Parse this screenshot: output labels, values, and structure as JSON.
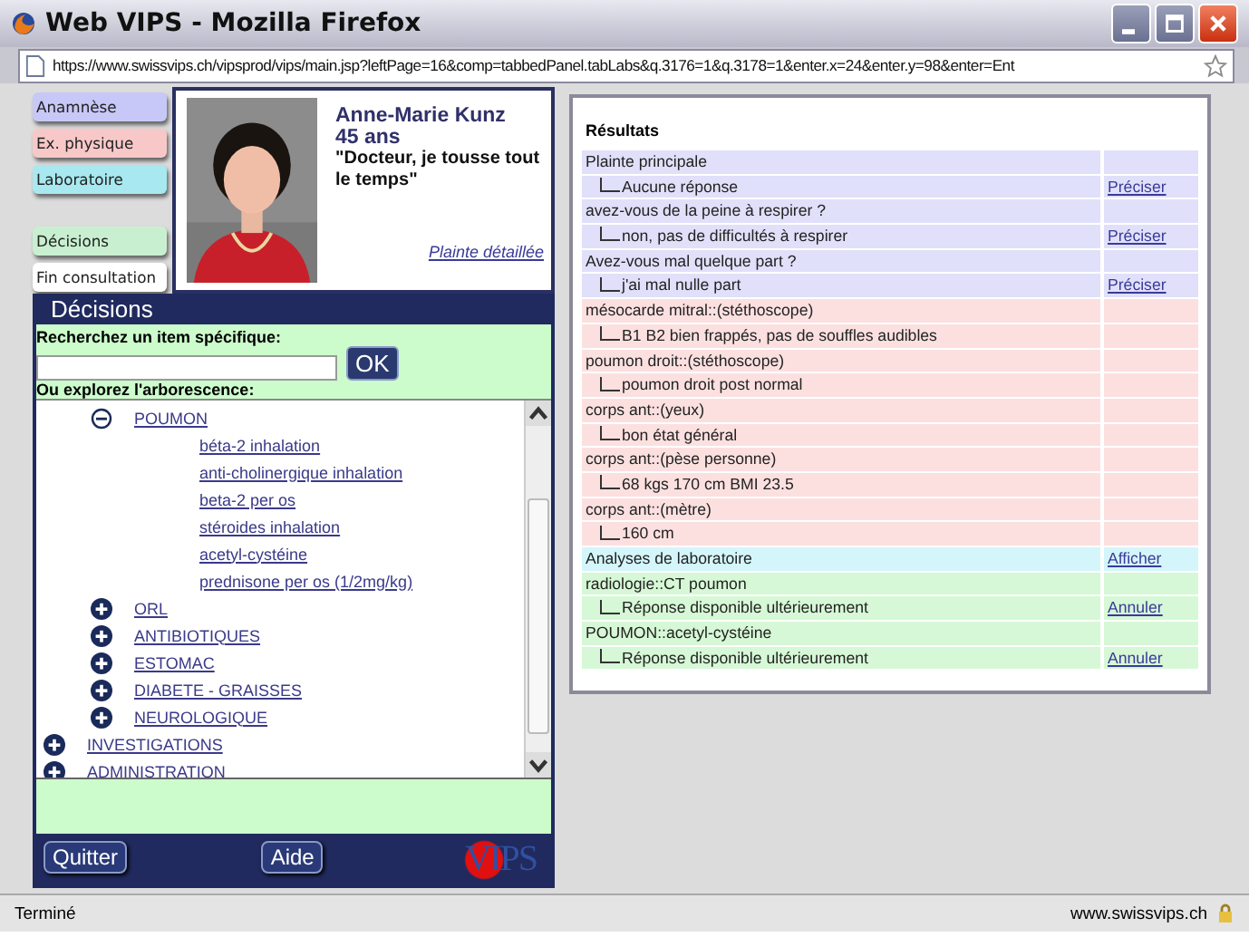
{
  "window": {
    "title": "Web VIPS - Mozilla Firefox"
  },
  "address_bar": {
    "url": "https://www.swissvips.ch/vipsprod/vips/main.jsp?leftPage=16&comp=tabbedPanel.tabLabs&q.3176=1&q.3178=1&enter.x=24&enter.y=98&enter=Ent"
  },
  "tabs": [
    {
      "label": "Anamnèse",
      "color": "#c8c8f8"
    },
    {
      "label": "Ex. physique",
      "color": "#f8c8c8"
    },
    {
      "label": "Laboratoire",
      "color": "#a8e8f0"
    },
    {
      "label": "Décisions",
      "color": "#c8f0d0"
    },
    {
      "label": "Fin consultation",
      "color": "#ffffff"
    }
  ],
  "patient": {
    "name": "Anne-Marie Kunz",
    "age": "45 ans",
    "complaint": "\"Docteur, je tousse tout le temps\"",
    "link": "Plainte détaillée"
  },
  "decisions": {
    "title": "Décisions",
    "search_label": "Recherchez un item spécifique:",
    "search_button": "OK",
    "tree_label": "Ou explorez l'arborescence:",
    "tree": [
      {
        "children": [
          {
            "label": "POUMON",
            "expanded": true,
            "children": [
              {
                "label": "béta-2 inhalation"
              },
              {
                "label": "anti-cholinergique inhalation"
              },
              {
                "label": "beta-2 per os"
              },
              {
                "label": "stéroides inhalation"
              },
              {
                "label": "acetyl-cystéine"
              },
              {
                "label": "prednisone per os (1/2mg/kg)"
              }
            ]
          },
          {
            "label": "ORL",
            "expanded": false
          },
          {
            "label": "ANTIBIOTIQUES",
            "expanded": false
          },
          {
            "label": "ESTOMAC",
            "expanded": false
          },
          {
            "label": "DIABETE - GRAISSES",
            "expanded": false
          },
          {
            "label": "NEUROLOGIQUE",
            "expanded": false
          }
        ]
      },
      {
        "label": "INVESTIGATIONS",
        "expanded": false
      },
      {
        "label": "ADMINISTRATION",
        "expanded": false
      }
    ],
    "buttons": [
      "Quitter",
      "Aide"
    ],
    "logo": "VIPS"
  },
  "results": {
    "title": "Résultats",
    "rows": [
      {
        "kind": "question",
        "text": "Plainte principale",
        "color": "#e0e0fa"
      },
      {
        "kind": "answer",
        "text": "Aucune réponse",
        "link": "Préciser",
        "color": "#e0e0fa"
      },
      {
        "kind": "question",
        "text": "avez-vous de la peine à respirer ?",
        "color": "#e0e0fa"
      },
      {
        "kind": "answer",
        "text": "non, pas de difficultés à respirer",
        "link": "Préciser",
        "color": "#e0e0fa"
      },
      {
        "kind": "question",
        "text": "Avez-vous mal quelque part ?",
        "color": "#e0e0fa"
      },
      {
        "kind": "answer",
        "text": "j'ai mal nulle part",
        "link": "Préciser",
        "color": "#e0e0fa"
      },
      {
        "kind": "question",
        "text": "mésocarde mitral::(stéthoscope)",
        "color": "#fce0e0"
      },
      {
        "kind": "answer",
        "text": "B1 B2 bien frappés, pas de souffles audibles",
        "color": "#fce0e0"
      },
      {
        "kind": "question",
        "text": "poumon droit::(stéthoscope)",
        "color": "#fce0e0"
      },
      {
        "kind": "answer",
        "text": "poumon droit post normal",
        "color": "#fce0e0"
      },
      {
        "kind": "question",
        "text": "corps ant::(yeux)",
        "color": "#fce0e0"
      },
      {
        "kind": "answer",
        "text": "bon état général",
        "color": "#fce0e0"
      },
      {
        "kind": "question",
        "text": "corps ant::(pèse personne)",
        "color": "#fce0e0"
      },
      {
        "kind": "answer",
        "text": "68 kgs 170 cm BMI 23.5",
        "color": "#fce0e0"
      },
      {
        "kind": "question",
        "text": "corps ant::(mètre)",
        "color": "#fce0e0"
      },
      {
        "kind": "answer",
        "text": "160 cm",
        "color": "#fce0e0"
      },
      {
        "kind": "question",
        "text": "Analyses de laboratoire",
        "link": "Afficher",
        "color": "#d4f6fa"
      },
      {
        "kind": "question",
        "text": "radiologie::CT poumon",
        "color": "#d6f8d6"
      },
      {
        "kind": "answer",
        "text": "Réponse disponible ultérieurement",
        "link": "Annuler",
        "color": "#d6f8d6"
      },
      {
        "kind": "question",
        "text": "POUMON::acetyl-cystéine",
        "color": "#d6f8d6"
      },
      {
        "kind": "answer",
        "text": "Réponse disponible ultérieurement",
        "link": "Annuler",
        "color": "#d6f8d6"
      }
    ]
  },
  "status_bar": {
    "text": "Terminé",
    "domain": "www.swissvips.ch"
  }
}
